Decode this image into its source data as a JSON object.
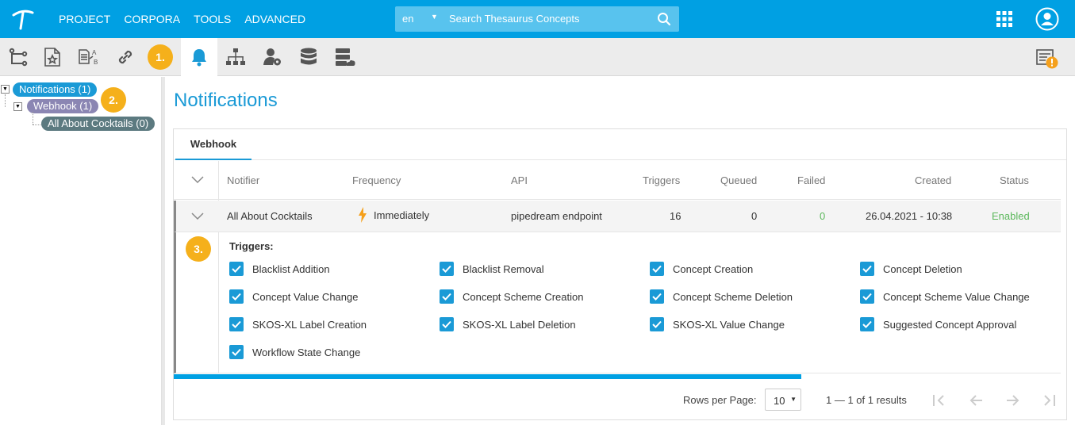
{
  "topbar": {
    "nav": [
      "PROJECT",
      "CORPORA",
      "TOOLS",
      "ADVANCED"
    ],
    "search_lang": "en",
    "search_placeholder": "Search Thesaurus Concepts",
    "accent_color": "#00a0e3"
  },
  "toolbar": {
    "icons": [
      "hierarchy-branch-icon",
      "starred-document-icon",
      "document-translate-icon",
      "link-icon",
      "notification-bell-icon",
      "org-chart-icon",
      "user-settings-icon",
      "database-icon",
      "server-cloud-icon"
    ],
    "active": "notification-bell-icon",
    "right_icon": "log-warning-icon"
  },
  "annotations": {
    "one": "1.",
    "two": "2.",
    "three": "3."
  },
  "tree": {
    "root": "Notifications (1)",
    "child": "Webhook (1)",
    "leaf": "All About Cocktails (0)"
  },
  "main": {
    "title": "Notifications",
    "tab": "Webhook",
    "columns": [
      "Notifier",
      "Frequency",
      "API",
      "Triggers",
      "Queued",
      "Failed",
      "Created",
      "Status"
    ],
    "row": {
      "notifier": "All About Cocktails",
      "frequency": "Immediately",
      "api": "pipedream endpoint",
      "triggers": "16",
      "queued": "0",
      "failed": "0",
      "created": "26.04.2021 - 10:38",
      "status": "Enabled"
    },
    "triggers_title": "Triggers:",
    "triggers": [
      "Blacklist Addition",
      "Blacklist Removal",
      "Concept Creation",
      "Concept Deletion",
      "Concept Value Change",
      "Concept Scheme Creation",
      "Concept Scheme Deletion",
      "Concept Scheme Value Change",
      "SKOS-XL Label Creation",
      "SKOS-XL Label Deletion",
      "SKOS-XL Value Change",
      "Suggested Concept Approval",
      "Workflow State Change"
    ],
    "triggers_checked": true
  },
  "footer": {
    "rows_per_page_label": "Rows per Page:",
    "rows_per_page": "10",
    "results": "1 — 1 of 1 results"
  },
  "colors": {
    "enabled": "#5cb85c",
    "title": "#1a9ad6",
    "badge": "#f5b01b"
  }
}
